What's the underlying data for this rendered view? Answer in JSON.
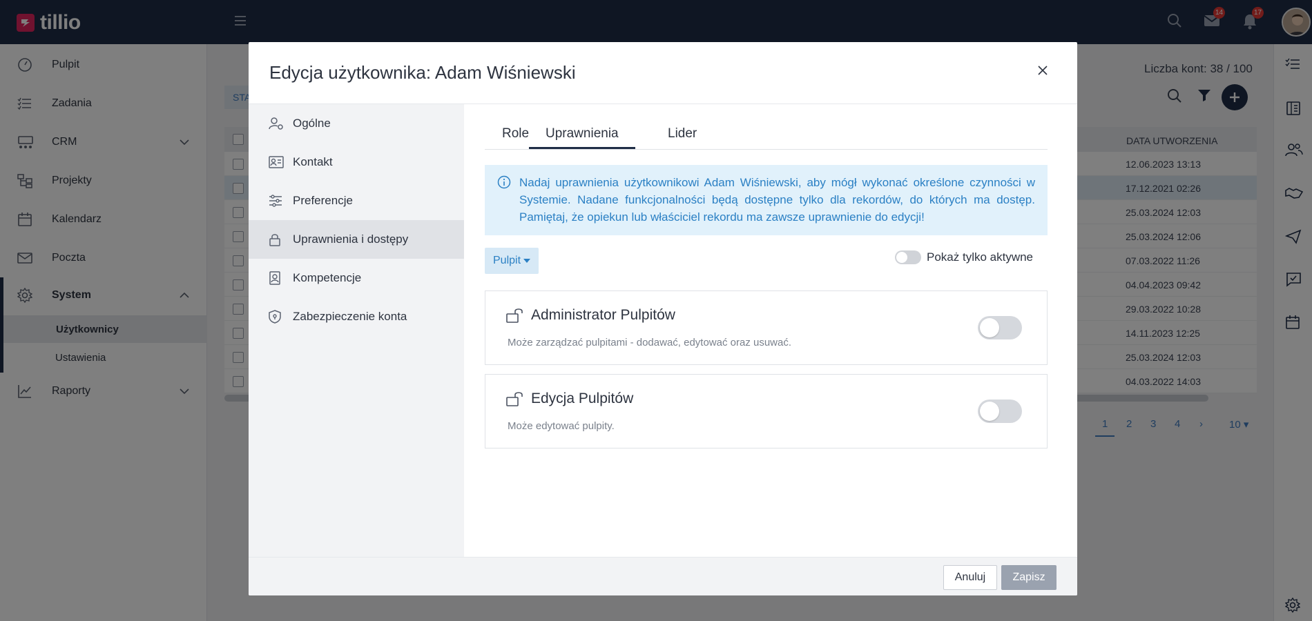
{
  "app": {
    "name": "tillio",
    "brand_color": "#e0245e",
    "nav_color": "#1f2d46"
  },
  "topbar": {
    "mail_badge": "14",
    "notif_badge": "17",
    "icons": [
      "menu-icon",
      "search-icon",
      "mail-icon",
      "bell-icon",
      "avatar"
    ]
  },
  "sidebar": {
    "items": [
      {
        "label": "Pulpit",
        "icon": "dashboard-icon"
      },
      {
        "label": "Zadania",
        "icon": "tasks-icon"
      },
      {
        "label": "CRM",
        "icon": "crm-icon"
      },
      {
        "label": "Projekty",
        "icon": "projects-icon"
      },
      {
        "label": "Kalendarz",
        "icon": "calendar-icon"
      },
      {
        "label": "Poczta",
        "icon": "mail-icon"
      },
      {
        "label": "System",
        "icon": "gear-icon"
      },
      {
        "label": "Raporty",
        "icon": "chart-icon"
      }
    ],
    "sub_items": [
      {
        "label": "Użytkownicy"
      },
      {
        "label": "Ustawienia"
      }
    ]
  },
  "background": {
    "counter": "Liczba kont: 38 / 100",
    "tag": "STA",
    "column_header": "DATA UTWORZENIA",
    "dates": [
      "12.06.2023 13:13",
      "17.12.2021 02:26",
      "25.03.2024 12:03",
      "25.03.2024 12:06",
      "07.03.2022 11:26",
      "04.04.2023 09:42",
      "29.03.2022 10:28",
      "14.11.2023 12:25",
      "25.03.2024 12:03",
      "04.03.2022 14:03"
    ],
    "pager": {
      "pages": [
        "1",
        "2",
        "3",
        "4"
      ],
      "next": "›",
      "per_page": "10"
    }
  },
  "modal": {
    "title": "Edycja użytkownika: Adam Wiśniewski",
    "side_menu": [
      {
        "label": "Ogólne",
        "icon": "user-gear-icon"
      },
      {
        "label": "Kontakt",
        "icon": "contact-card-icon"
      },
      {
        "label": "Preferencje",
        "icon": "sliders-icon"
      },
      {
        "label": "Uprawnienia i dostępy",
        "icon": "lock-icon"
      },
      {
        "label": "Kompetencje",
        "icon": "badge-icon"
      },
      {
        "label": "Zabezpieczenie konta",
        "icon": "shield-icon"
      }
    ],
    "tabs": [
      {
        "label": "Role"
      },
      {
        "label": "Uprawnienia"
      },
      {
        "label": "Lider"
      }
    ],
    "info_text": "Nadaj uprawnienia użytkownikowi Adam Wiśniewski, aby mógł wykonać określone czynności w Systemie. Nadane funkcjonalności będą dostępne tylko dla rekordów, do których ma dostęp. Pamiętaj, że opiekun lub właściciel rekordu ma zawsze uprawnienie do edycji!",
    "module_select": "Pulpit",
    "only_active_label": "Pokaż tylko aktywne",
    "only_active": false,
    "permissions": [
      {
        "title": "Administrator Pulpitów",
        "desc": "Może zarządzać pulpitami - dodawać, edytować oraz usuwać.",
        "enabled": false
      },
      {
        "title": "Edycja Pulpitów",
        "desc": "Może edytować pulpity.",
        "enabled": false
      }
    ],
    "cancel_label": "Anuluj",
    "save_label": "Zapisz"
  }
}
